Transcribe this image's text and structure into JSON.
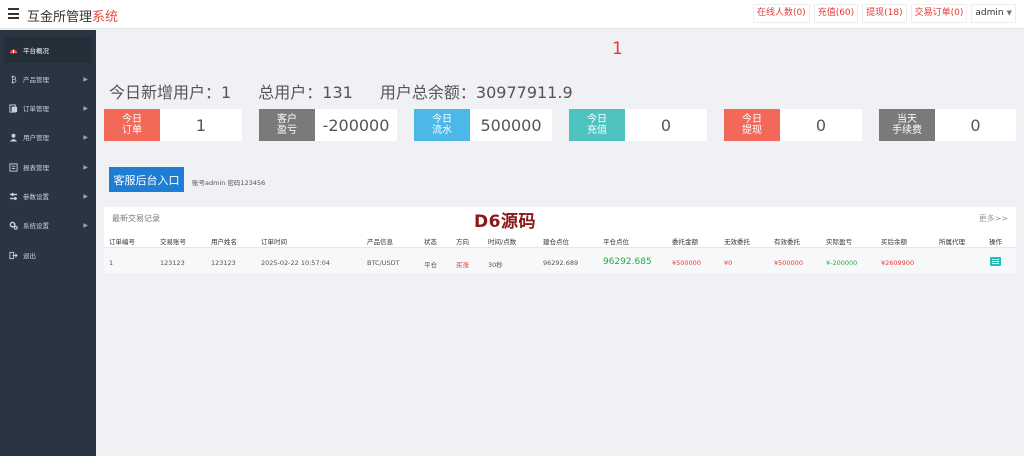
{
  "header": {
    "brand_main": "互金所管理",
    "brand_accent": "系统",
    "links": {
      "online": "在线人数(0)",
      "recharge": "充值(60)",
      "withdraw": "提现(18)",
      "orders": "交易订单(0)",
      "admin": "admin"
    }
  },
  "sidebar": {
    "items": [
      {
        "label": "平台概况",
        "icon": "dashboard-icon"
      },
      {
        "label": "产品管理",
        "icon": "bitcoin-icon"
      },
      {
        "label": "订单管理",
        "icon": "document-icon"
      },
      {
        "label": "用户管理",
        "icon": "user-icon"
      },
      {
        "label": "报表管理",
        "icon": "report-icon"
      },
      {
        "label": "参数设置",
        "icon": "sliders-icon"
      },
      {
        "label": "系统设置",
        "icon": "gear-icon"
      },
      {
        "label": "退出",
        "icon": "logout-icon"
      }
    ]
  },
  "main": {
    "page_number": "1",
    "stats": {
      "new_users": "今日新增用户：1",
      "total_users": "总用户：131",
      "total_balance": "用户总余额：30977911.9"
    },
    "cards": [
      {
        "label": "今日\n订单",
        "value": "1",
        "color": "#f2695a"
      },
      {
        "label": "客户\n盈亏",
        "value": "-200000",
        "color": "#7a7a7a"
      },
      {
        "label": "今日\n流水",
        "value": "500000",
        "color": "#4cb8e8"
      },
      {
        "label": "今日\n充值",
        "value": "0",
        "color": "#4ec3c0"
      },
      {
        "label": "今日\n提现",
        "value": "0",
        "color": "#f2695a"
      },
      {
        "label": "当天\n手续费",
        "value": "0",
        "color": "#7a7a7a"
      }
    ],
    "cs_button": "客服后台入口",
    "cs_note": "账号admin 密码123456"
  },
  "panel": {
    "title": "最新交易记录",
    "more": "更多>>",
    "watermark": "D6源码",
    "columns": [
      "订单编号",
      "交易账号",
      "用户姓名",
      "订单时间",
      "产品信息",
      "状态",
      "方向",
      "时间/点数",
      "建仓点位",
      "平仓点位",
      "委托金额",
      "无效委托",
      "有效委托",
      "实际盈亏",
      "买后余额",
      "所属代理",
      "操作"
    ],
    "row": {
      "order_id": "1",
      "account": "123123",
      "name": "123123",
      "time": "2025-02-22 10:57:04",
      "product": "BTC/USDT",
      "status": "平仓",
      "direction": "买涨",
      "duration": "30秒",
      "open_price": "96292.689",
      "close_price": "96292.685",
      "amount": "¥500000",
      "invalid": "¥0",
      "valid": "¥500000",
      "pnl": "¥-200000",
      "balance": "¥2609900",
      "agent": ""
    }
  }
}
